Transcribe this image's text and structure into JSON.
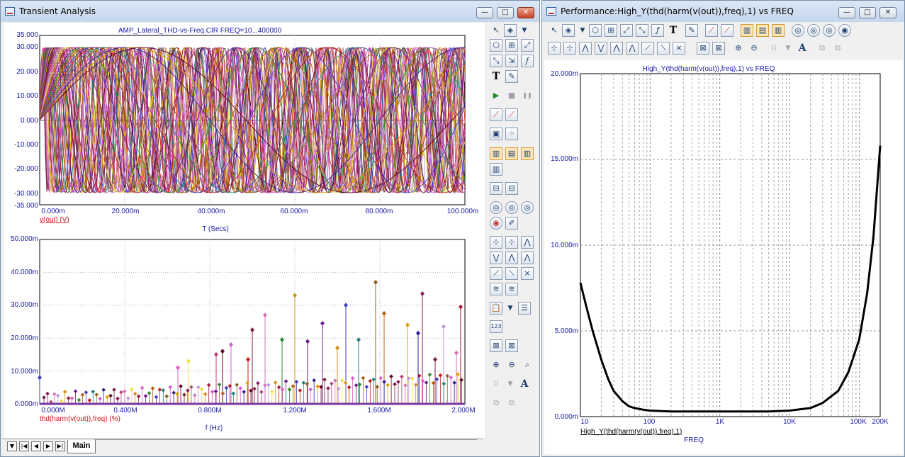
{
  "transient_window": {
    "title": "Transient Analysis",
    "window_buttons": {
      "minimize": "—",
      "maximize": "□",
      "close": "✕"
    },
    "top_plot": {
      "title": "AMP_Lateral_THD-vs-Freq.CIR FREQ=10...400000",
      "y_ticks": [
        "35.000",
        "30.000",
        "20.000",
        "10.000",
        "0.000",
        "-10.000",
        "-20.000",
        "-30.000",
        "-35.000"
      ],
      "x_ticks": [
        "0.000m",
        "20.000m",
        "40.000m",
        "60.000m",
        "80.000m",
        "100.000m"
      ],
      "trace_label": "v(out) (V)",
      "x_axis_label": "T (Secs)"
    },
    "bottom_plot": {
      "y_ticks": [
        "50.000m",
        "40.000m",
        "30.000m",
        "20.000m",
        "10.000m",
        "0.000m"
      ],
      "x_ticks": [
        "0.000M",
        "0.400M",
        "0.800M",
        "1.200M",
        "1.600M",
        "2.000M"
      ],
      "trace_label": "thd(harm(v(out)),freq) (%)",
      "x_axis_label": "f (Hz)"
    },
    "tab": {
      "label": "Main"
    },
    "nav_buttons": [
      "▼",
      "|◀",
      "◀",
      "▶",
      "▶|"
    ]
  },
  "performance_window": {
    "title": "Performance:High_Y(thd(harm(v(out)),freq),1) vs FREQ",
    "window_buttons": {
      "minimize": "—",
      "maximize": "□",
      "close": "✕"
    },
    "plot": {
      "title": "High_Y(thd(harm(v(out)),freq),1) vs FREQ",
      "y_ticks": [
        "20.000m",
        "15.000m",
        "10.000m",
        "5.000m",
        "0.000m"
      ],
      "x_ticks": [
        "10",
        "100",
        "1K",
        "10K",
        "100K",
        "200K"
      ],
      "trace_label": "High_Y(thd(harm(v(out)),freq),1)",
      "x_axis_label": "FREQ"
    }
  },
  "toolbar_icons": {
    "text_tool": "T",
    "font_tool": "A",
    "run": "▶",
    "stop": "■",
    "pause": "❚❚"
  },
  "colors": {
    "axis_text": "#1a1aa8",
    "trace_label": "#c81818",
    "perf_trace": "#000000",
    "title_bar": "#c4d6ec"
  },
  "chart_data": [
    {
      "type": "line",
      "title": "AMP_Lateral_THD-vs-Freq.CIR FREQ=10...400000",
      "xlabel": "T (Secs)",
      "ylabel": "v(out) (V)",
      "xlim": [
        0,
        0.1
      ],
      "ylim": [
        -35,
        35
      ],
      "amplitude": 30,
      "grid": true,
      "series_count": 40,
      "periods_s": [
        0.0023,
        0.0025,
        0.0028,
        0.0031,
        0.0034,
        0.0037,
        0.0041,
        0.0045,
        0.005,
        0.0055,
        0.006,
        0.0066,
        0.0073,
        0.008,
        0.0088,
        0.0097,
        0.0107,
        0.0118,
        0.013,
        0.0143,
        0.0157,
        0.0173,
        0.019,
        0.0209,
        0.023,
        0.0253,
        0.0278,
        0.0306,
        0.0337,
        0.037,
        0.0407,
        0.0448,
        0.0493,
        0.0542,
        0.06,
        0.066,
        0.073,
        0.08,
        0.088,
        0.097
      ]
    },
    {
      "type": "scatter",
      "xlabel": "f (Hz)",
      "ylabel": "thd(harm(v(out)),freq) (%)",
      "xlim": [
        0,
        2000000
      ],
      "ylim": [
        0,
        0.05
      ],
      "grid": true,
      "series": [
        {
          "name": "thd(harm(v(out)),freq) (%)",
          "x": [
            1000000,
            1060000,
            1200000,
            1330000,
            1440000,
            1580000,
            1730000,
            1800000,
            1900000,
            1980000,
            1140000,
            980000,
            900000,
            860000,
            830000,
            700000,
            650000,
            1620000,
            1500000,
            1780000,
            1860000,
            1960000,
            1400000,
            1260000,
            0
          ],
          "y": [
            0.0225,
            0.027,
            0.033,
            0.0245,
            0.03,
            0.037,
            0.024,
            0.0335,
            0.0235,
            0.0295,
            0.0195,
            0.0135,
            0.018,
            0.016,
            0.015,
            0.013,
            0.011,
            0.0275,
            0.0195,
            0.0215,
            0.0135,
            0.0155,
            0.017,
            0.019,
            0.008
          ]
        }
      ]
    },
    {
      "type": "line",
      "title": "High_Y(thd(harm(v(out)),freq),1) vs FREQ",
      "xlabel": "FREQ",
      "ylabel": "High_Y(thd(harm(v(out)),freq),1)",
      "xlim": [
        10,
        200000
      ],
      "x_scale": "log",
      "ylim": [
        0,
        0.02
      ],
      "grid": true,
      "series": [
        {
          "name": "High_Y(thd(harm(v(out)),freq),1)",
          "x": [
            10,
            12,
            15,
            20,
            25,
            30,
            40,
            50,
            60,
            80,
            100,
            200,
            500,
            1000,
            2000,
            5000,
            10000,
            20000,
            30000,
            50000,
            70000,
            100000,
            130000,
            160000,
            200000
          ],
          "y": [
            0.0078,
            0.0065,
            0.005,
            0.0033,
            0.0022,
            0.0015,
            0.0009,
            0.0006,
            0.0005,
            0.0004,
            0.00035,
            0.0003,
            0.0003,
            0.0003,
            0.0003,
            0.0003,
            0.00035,
            0.0005,
            0.0008,
            0.0015,
            0.0026,
            0.0045,
            0.0072,
            0.0105,
            0.0158
          ]
        }
      ]
    }
  ]
}
